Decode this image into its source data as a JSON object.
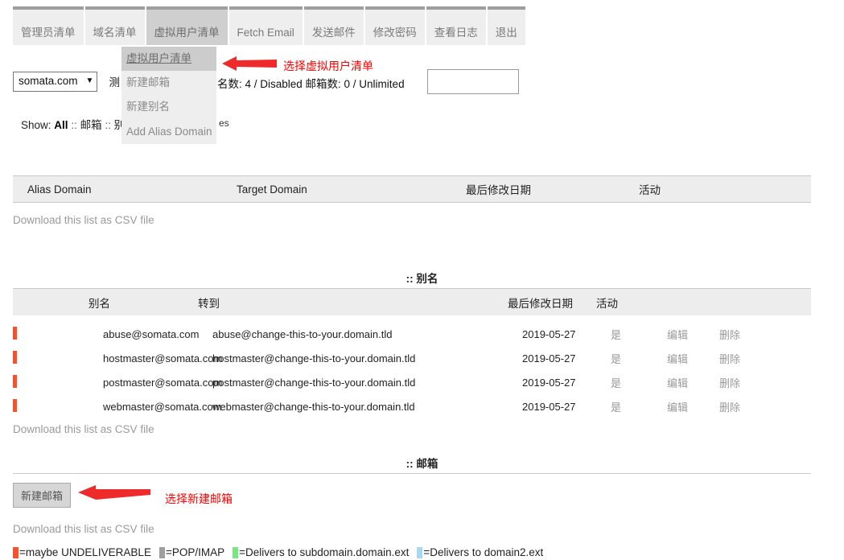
{
  "tabs": [
    {
      "label": "管理员清单",
      "active": false
    },
    {
      "label": "域名清单",
      "active": false
    },
    {
      "label": "虚拟用户清单",
      "active": true
    },
    {
      "label": "Fetch Email",
      "active": false
    },
    {
      "label": "发送邮件",
      "active": false
    },
    {
      "label": "修改密码",
      "active": false
    },
    {
      "label": "查看日志",
      "active": false
    },
    {
      "label": "退出",
      "active": false
    }
  ],
  "dropdown": {
    "items": [
      {
        "label": "虚拟用户清单",
        "hovered": true
      },
      {
        "label": "新建邮箱",
        "hovered": false
      },
      {
        "label": "新建别名",
        "hovered": false
      },
      {
        "label": "Add Alias Domain",
        "hovered": false
      }
    ]
  },
  "annotations": [
    {
      "text": "选择虚拟用户清单",
      "color": "#ff0000"
    },
    {
      "text": "选择新建邮箱",
      "color": "#ff0000"
    }
  ],
  "domain_row": {
    "selected_domain": "somata.com",
    "caret": "▼",
    "partial_label": "测",
    "meta": "名数: 4 / Disabled   邮箱数: 0 / Unlimited"
  },
  "top_input": {
    "value": "",
    "placeholder": ""
  },
  "show_line": {
    "prefix": "Show:",
    "all": "All",
    "sep": "::",
    "mailbox": "邮箱",
    "alias": "别",
    "tail": "es"
  },
  "alias_domain_table": {
    "headers": [
      "Alias Domain",
      "Target Domain",
      "最后修改日期",
      "活动"
    ],
    "rows": [],
    "csv_link": "Download this list as CSV file"
  },
  "alias_section": {
    "title": ":: 别名",
    "headers": [
      "别名",
      "转到",
      "最后修改日期",
      "活动"
    ],
    "rows": [
      {
        "alias": "abuse@somata.com",
        "goto": "abuse@change-this-to-your.domain.tld",
        "modified": "2019-05-27",
        "active": "是",
        "edit": "编辑",
        "delete": "删除"
      },
      {
        "alias": "hostmaster@somata.com",
        "goto": "hostmaster@change-this-to-your.domain.tld",
        "modified": "2019-05-27",
        "active": "是",
        "edit": "编辑",
        "delete": "删除"
      },
      {
        "alias": "postmaster@somata.com",
        "goto": "postmaster@change-this-to-your.domain.tld",
        "modified": "2019-05-27",
        "active": "是",
        "edit": "编辑",
        "delete": "删除"
      },
      {
        "alias": "webmaster@somata.com",
        "goto": "webmaster@change-this-to-your.domain.tld",
        "modified": "2019-05-27",
        "active": "是",
        "edit": "编辑",
        "delete": "删除"
      }
    ],
    "csv_link": "Download this list as CSV file"
  },
  "mailbox_section": {
    "title": ":: 邮箱",
    "new_button": "新建邮箱",
    "csv_link": "Download this list as CSV file"
  },
  "legend": [
    {
      "color": "#f4512c",
      "text": "=maybe UNDELIVERABLE"
    },
    {
      "color": "#9e9e9e",
      "text": "=POP/IMAP"
    },
    {
      "color": "#79e77f",
      "text": "=Delivers to subdomain.domain.ext"
    },
    {
      "color": "#a6d9ef",
      "text": "=Delivers to domain2.ext"
    }
  ],
  "colors": {
    "flag_red": "#f4512c",
    "tab_active": "#cfcfcf",
    "tab_inactive": "#eeeeee",
    "tab_topborder": "#9e9e9e",
    "annotation_red": "#ff0000",
    "header_bg": "#ededed"
  }
}
